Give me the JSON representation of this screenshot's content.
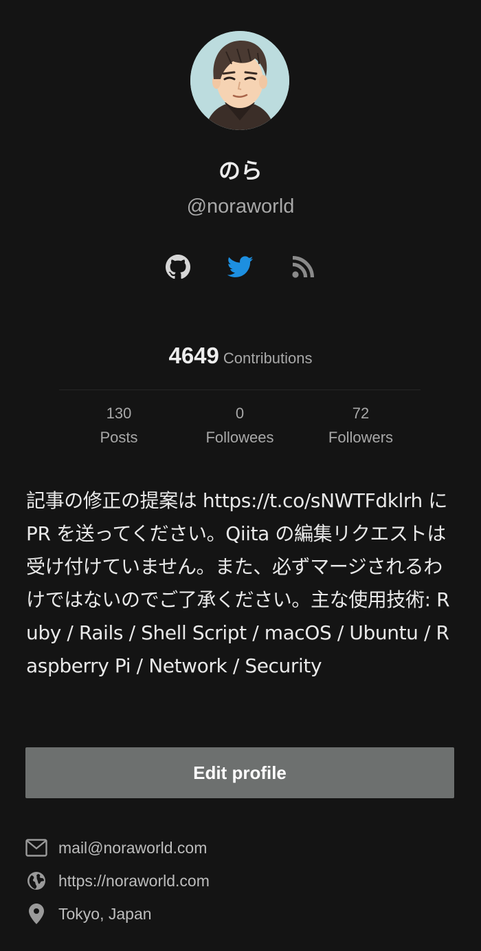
{
  "profile": {
    "display_name": "のら",
    "username": "@noraworld",
    "avatar_icon": "avatar-illustration"
  },
  "social": {
    "github_icon": "github-icon",
    "twitter_icon": "twitter-icon",
    "rss_icon": "rss-icon",
    "twitter_color": "#1d8fe0",
    "icon_color": "#d6d6d6"
  },
  "contributions": {
    "count": "4649",
    "label": "Contributions"
  },
  "stats": [
    {
      "value": "130",
      "label": "Posts"
    },
    {
      "value": "0",
      "label": "Followees"
    },
    {
      "value": "72",
      "label": "Followers"
    }
  ],
  "bio": "記事の修正の提案は https://t.co/sNWTFdklrh に PR を送ってください。Qiita の編集リクエストは受け付けていません。また、必ずマージされるわけではないのでご了承ください。主な使用技術: Ruby / Rails / Shell Script / macOS / Ubuntu / Raspberry Pi / Network / Security",
  "actions": {
    "edit_profile_label": "Edit profile"
  },
  "info": {
    "email": "mail@noraworld.com",
    "website": "https://noraworld.com",
    "location": "Tokyo, Japan"
  },
  "colors": {
    "background": "#141414",
    "button": "#6d706f",
    "text_primary": "#ededed",
    "text_secondary": "#a8a8a8"
  }
}
